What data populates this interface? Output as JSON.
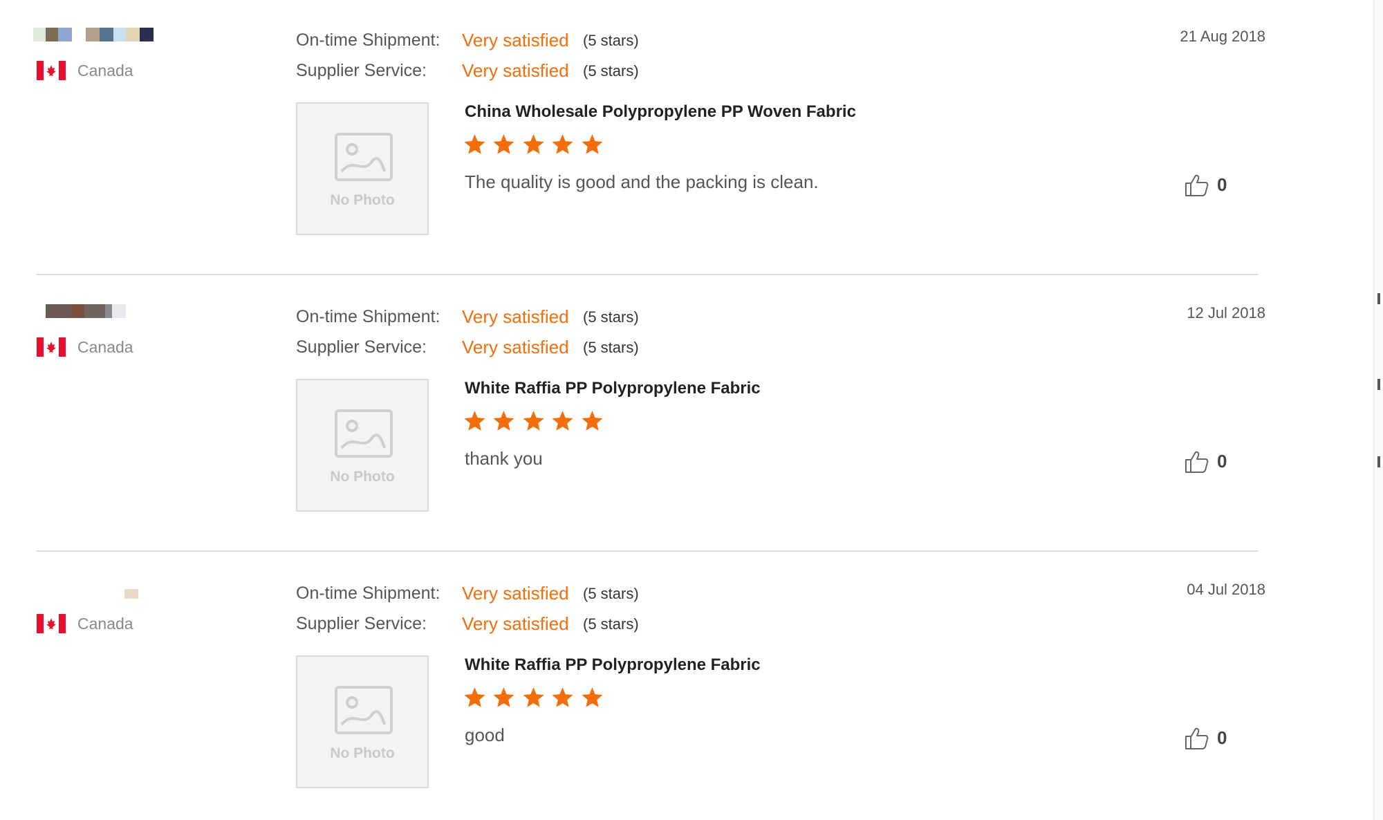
{
  "reviews": [
    {
      "country": "Canada",
      "date": "21 Aug 2018",
      "shipment": {
        "label": "On-time Shipment:",
        "value": "Very satisfied",
        "stars_text": "(5 stars)"
      },
      "service": {
        "label": "Supplier Service:",
        "value": "Very satisfied",
        "stars_text": "(5 stars)"
      },
      "photo_label": "No Photo",
      "product": "China Wholesale Polypropylene PP Woven Fabric",
      "rating": 5,
      "comment": "The quality is good and the packing is clean.",
      "likes": "0"
    },
    {
      "country": "Canada",
      "date": "12 Jul 2018",
      "shipment": {
        "label": "On-time Shipment:",
        "value": "Very satisfied",
        "stars_text": "(5 stars)"
      },
      "service": {
        "label": "Supplier Service:",
        "value": "Very satisfied",
        "stars_text": "(5 stars)"
      },
      "photo_label": "No Photo",
      "product": "White Raffia PP Polypropylene Fabric",
      "rating": 5,
      "comment": "thank you",
      "likes": "0"
    },
    {
      "country": "Canada",
      "date": "04 Jul 2018",
      "shipment": {
        "label": "On-time Shipment:",
        "value": "Very satisfied",
        "stars_text": "(5 stars)"
      },
      "service": {
        "label": "Supplier Service:",
        "value": "Very satisfied",
        "stars_text": "(5 stars)"
      },
      "photo_label": "No Photo",
      "product": "White Raffia PP Polypropylene Fabric",
      "rating": 5,
      "comment": "good",
      "likes": "0"
    }
  ],
  "colors": {
    "accent": "#f26e0b",
    "flag_red": "#e8112d",
    "divider": "#dcdcdc"
  },
  "icons": {
    "flag": "canada-flag-icon",
    "photo": "image-placeholder-icon",
    "star": "star-icon",
    "like": "thumbs-up-icon"
  }
}
